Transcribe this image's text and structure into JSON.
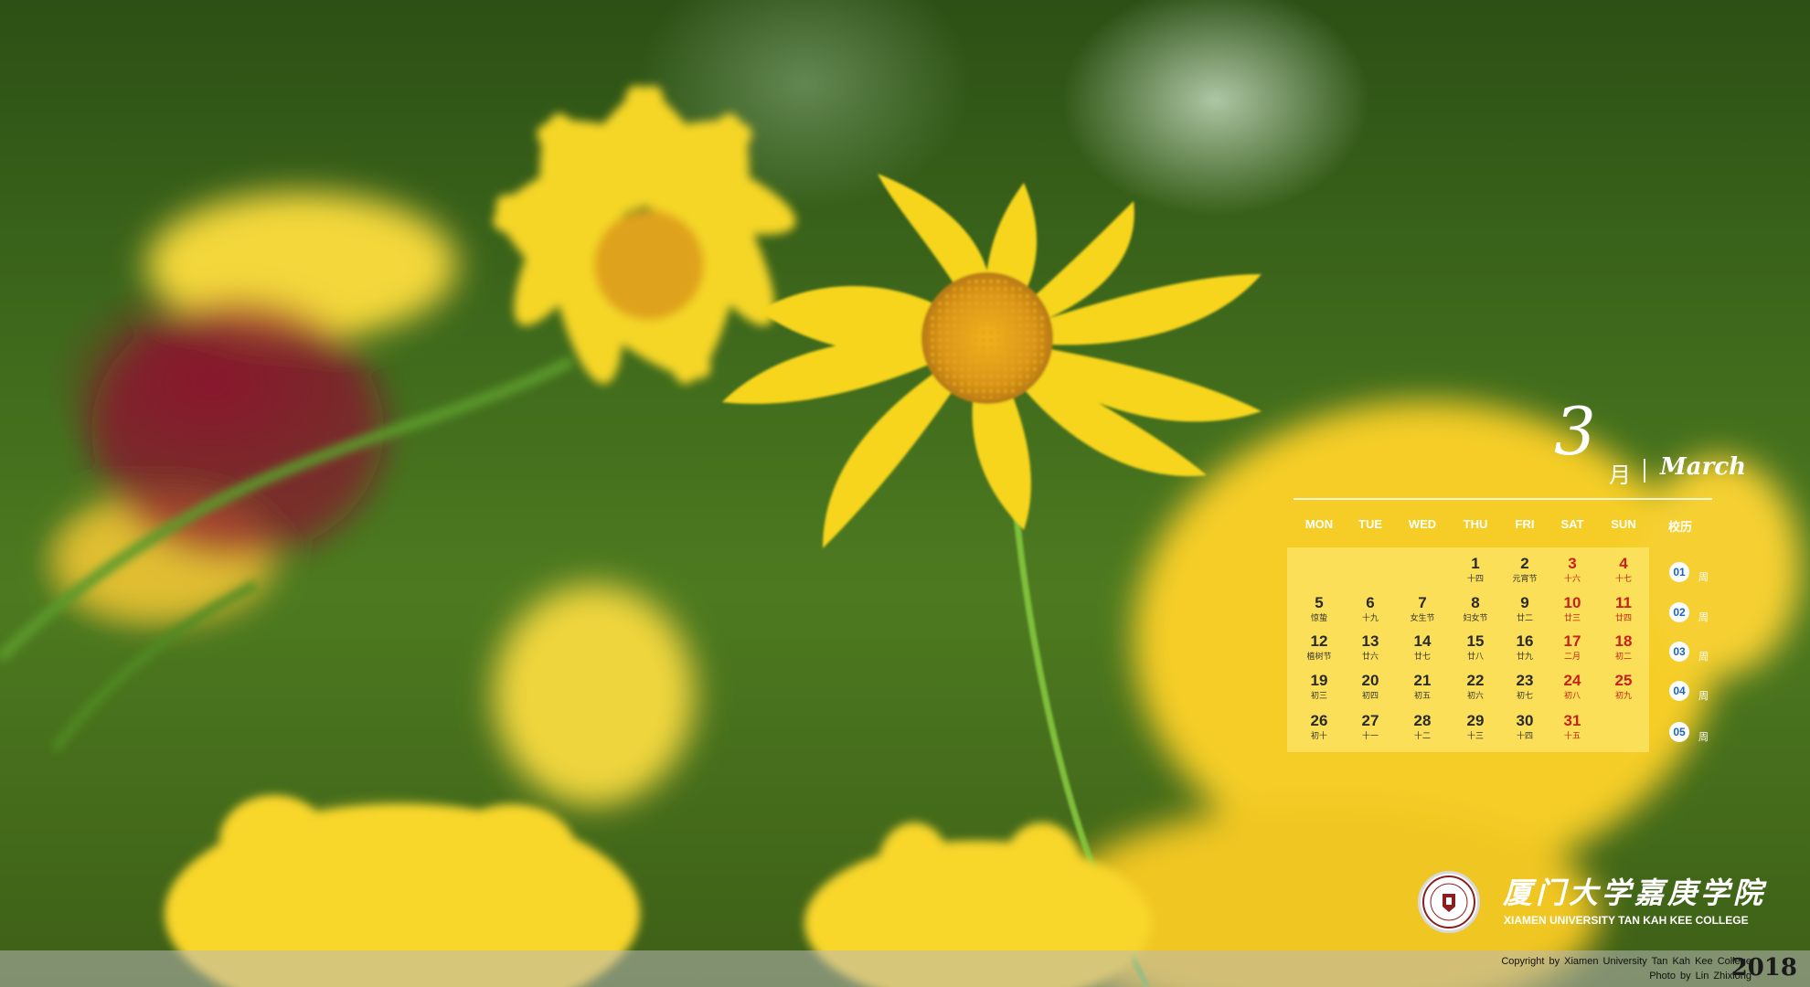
{
  "calendar": {
    "month_number": "3",
    "month_cn": "月",
    "month_en": "March",
    "weekdays": [
      "MON",
      "TUE",
      "WED",
      "THU",
      "FRI",
      "SAT",
      "SUN"
    ],
    "school_calendar_label": "校历",
    "weeks": [
      [
        null,
        null,
        null,
        {
          "d": "1",
          "l": "十四"
        },
        {
          "d": "2",
          "l": "元宵节"
        },
        {
          "d": "3",
          "l": "十六"
        },
        {
          "d": "4",
          "l": "十七"
        }
      ],
      [
        {
          "d": "5",
          "l": "惊蛰"
        },
        {
          "d": "6",
          "l": "十九"
        },
        {
          "d": "7",
          "l": "女生节"
        },
        {
          "d": "8",
          "l": "妇女节"
        },
        {
          "d": "9",
          "l": "廿二"
        },
        {
          "d": "10",
          "l": "廿三"
        },
        {
          "d": "11",
          "l": "廿四"
        }
      ],
      [
        {
          "d": "12",
          "l": "植树节"
        },
        {
          "d": "13",
          "l": "廿六"
        },
        {
          "d": "14",
          "l": "廿七"
        },
        {
          "d": "15",
          "l": "廿八"
        },
        {
          "d": "16",
          "l": "廿九"
        },
        {
          "d": "17",
          "l": "二月"
        },
        {
          "d": "18",
          "l": "初二"
        }
      ],
      [
        {
          "d": "19",
          "l": "初三"
        },
        {
          "d": "20",
          "l": "初四"
        },
        {
          "d": "21",
          "l": "初五"
        },
        {
          "d": "22",
          "l": "初六"
        },
        {
          "d": "23",
          "l": "初七"
        },
        {
          "d": "24",
          "l": "初八"
        },
        {
          "d": "25",
          "l": "初九"
        }
      ],
      [
        {
          "d": "26",
          "l": "初十"
        },
        {
          "d": "27",
          "l": "十一"
        },
        {
          "d": "28",
          "l": "十二"
        },
        {
          "d": "29",
          "l": "十三"
        },
        {
          "d": "30",
          "l": "十四"
        },
        {
          "d": "31",
          "l": "十五"
        },
        null
      ]
    ],
    "holiday_color": "#c8201a",
    "school_weeks": [
      {
        "num": "01",
        "label": "周"
      },
      {
        "num": "02",
        "label": "周"
      },
      {
        "num": "03",
        "label": "周"
      },
      {
        "num": "04",
        "label": "周"
      },
      {
        "num": "05",
        "label": "周"
      }
    ]
  },
  "college": {
    "name_cn": "厦门大学嘉庚学院",
    "name_en": "XIAMEN UNIVERSITY TAN KAH KEE COLLEGE"
  },
  "footer": {
    "copyright": "Copyright by Xiamen University Tan Kah Kee College",
    "photo_credit": "Photo by Lin Zhixiong",
    "year": "2018"
  },
  "colors": {
    "accent_blue": "#1c64b8",
    "petal_yellow": "#f6d51c"
  }
}
